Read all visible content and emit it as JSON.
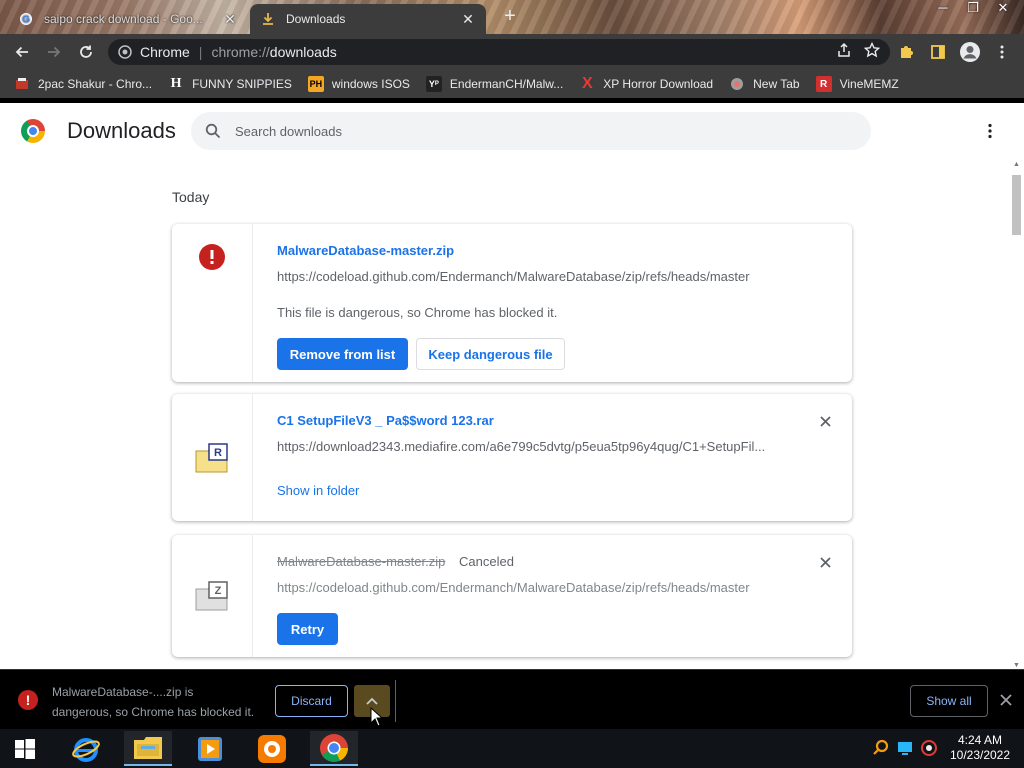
{
  "window": {
    "tabs": [
      {
        "title": "saipo crack download - Goo...",
        "icon": "google-icon"
      },
      {
        "title": "Downloads",
        "icon": "download-icon"
      }
    ],
    "controls": [
      "minimize",
      "maximize",
      "close"
    ]
  },
  "toolbar": {
    "site_label": "Chrome",
    "url_scheme": "chrome://",
    "url_path": "downloads"
  },
  "bookmarks": [
    {
      "label": "2pac Shakur - Chro...",
      "icon": "bookmark-favicon-tupac",
      "color": "#c0392b"
    },
    {
      "label": "FUNNY SNIPPIES",
      "icon": "bookmark-favicon-h",
      "color": "#ffffff",
      "glyph": "H"
    },
    {
      "label": "windows ISOS",
      "icon": "bookmark-favicon-ph",
      "color": "#f5a623",
      "glyph": "PH"
    },
    {
      "label": "EndermanCH/Malw...",
      "icon": "bookmark-favicon-yp",
      "color": "#333333",
      "glyph": "Y"
    },
    {
      "label": "XP Horror Download",
      "icon": "bookmark-favicon-x",
      "color": "#e53935",
      "glyph": "X"
    },
    {
      "label": "New Tab",
      "icon": "bookmark-favicon-newtab",
      "color": "#888888"
    },
    {
      "label": "VineMEMZ",
      "icon": "bookmark-favicon-r",
      "color": "#d32f2f",
      "glyph": "R"
    }
  ],
  "page": {
    "title": "Downloads",
    "search_placeholder": "Search downloads",
    "section": "Today"
  },
  "downloads": [
    {
      "filename": "MalwareDatabase-master.zip",
      "url": "https://codeload.github.com/Endermanch/MalwareDatabase/zip/refs/heads/master",
      "description": "This file is dangerous, so Chrome has blocked it.",
      "primary_button": "Remove from list",
      "secondary_button": "Keep dangerous file"
    },
    {
      "filename": "C1 SetupFileV3 _ Pa$$word 123.rar",
      "url": "https://download2343.mediafire.com/a6e799c5dvtg/p5eua5tp96y4qug/C1+SetupFil...",
      "link": "Show in folder"
    },
    {
      "filename": "MalwareDatabase-master.zip",
      "status": "Canceled",
      "url": "https://codeload.github.com/Endermanch/MalwareDatabase/zip/refs/heads/master",
      "primary_button": "Retry"
    }
  ],
  "shelf": {
    "message_line1": "MalwareDatabase-....zip is",
    "message_line2": "dangerous, so Chrome has blocked it.",
    "discard_label": "Discard",
    "show_all_label": "Show all"
  },
  "taskbar": {
    "apps": [
      "internet-explorer-icon",
      "file-explorer-icon",
      "media-player-icon",
      "uc-browser-icon",
      "chrome-icon"
    ],
    "time": "4:24 AM",
    "date": "10/23/2022"
  },
  "colors": {
    "accent": "#1a73e8",
    "danger": "#c5221f"
  }
}
